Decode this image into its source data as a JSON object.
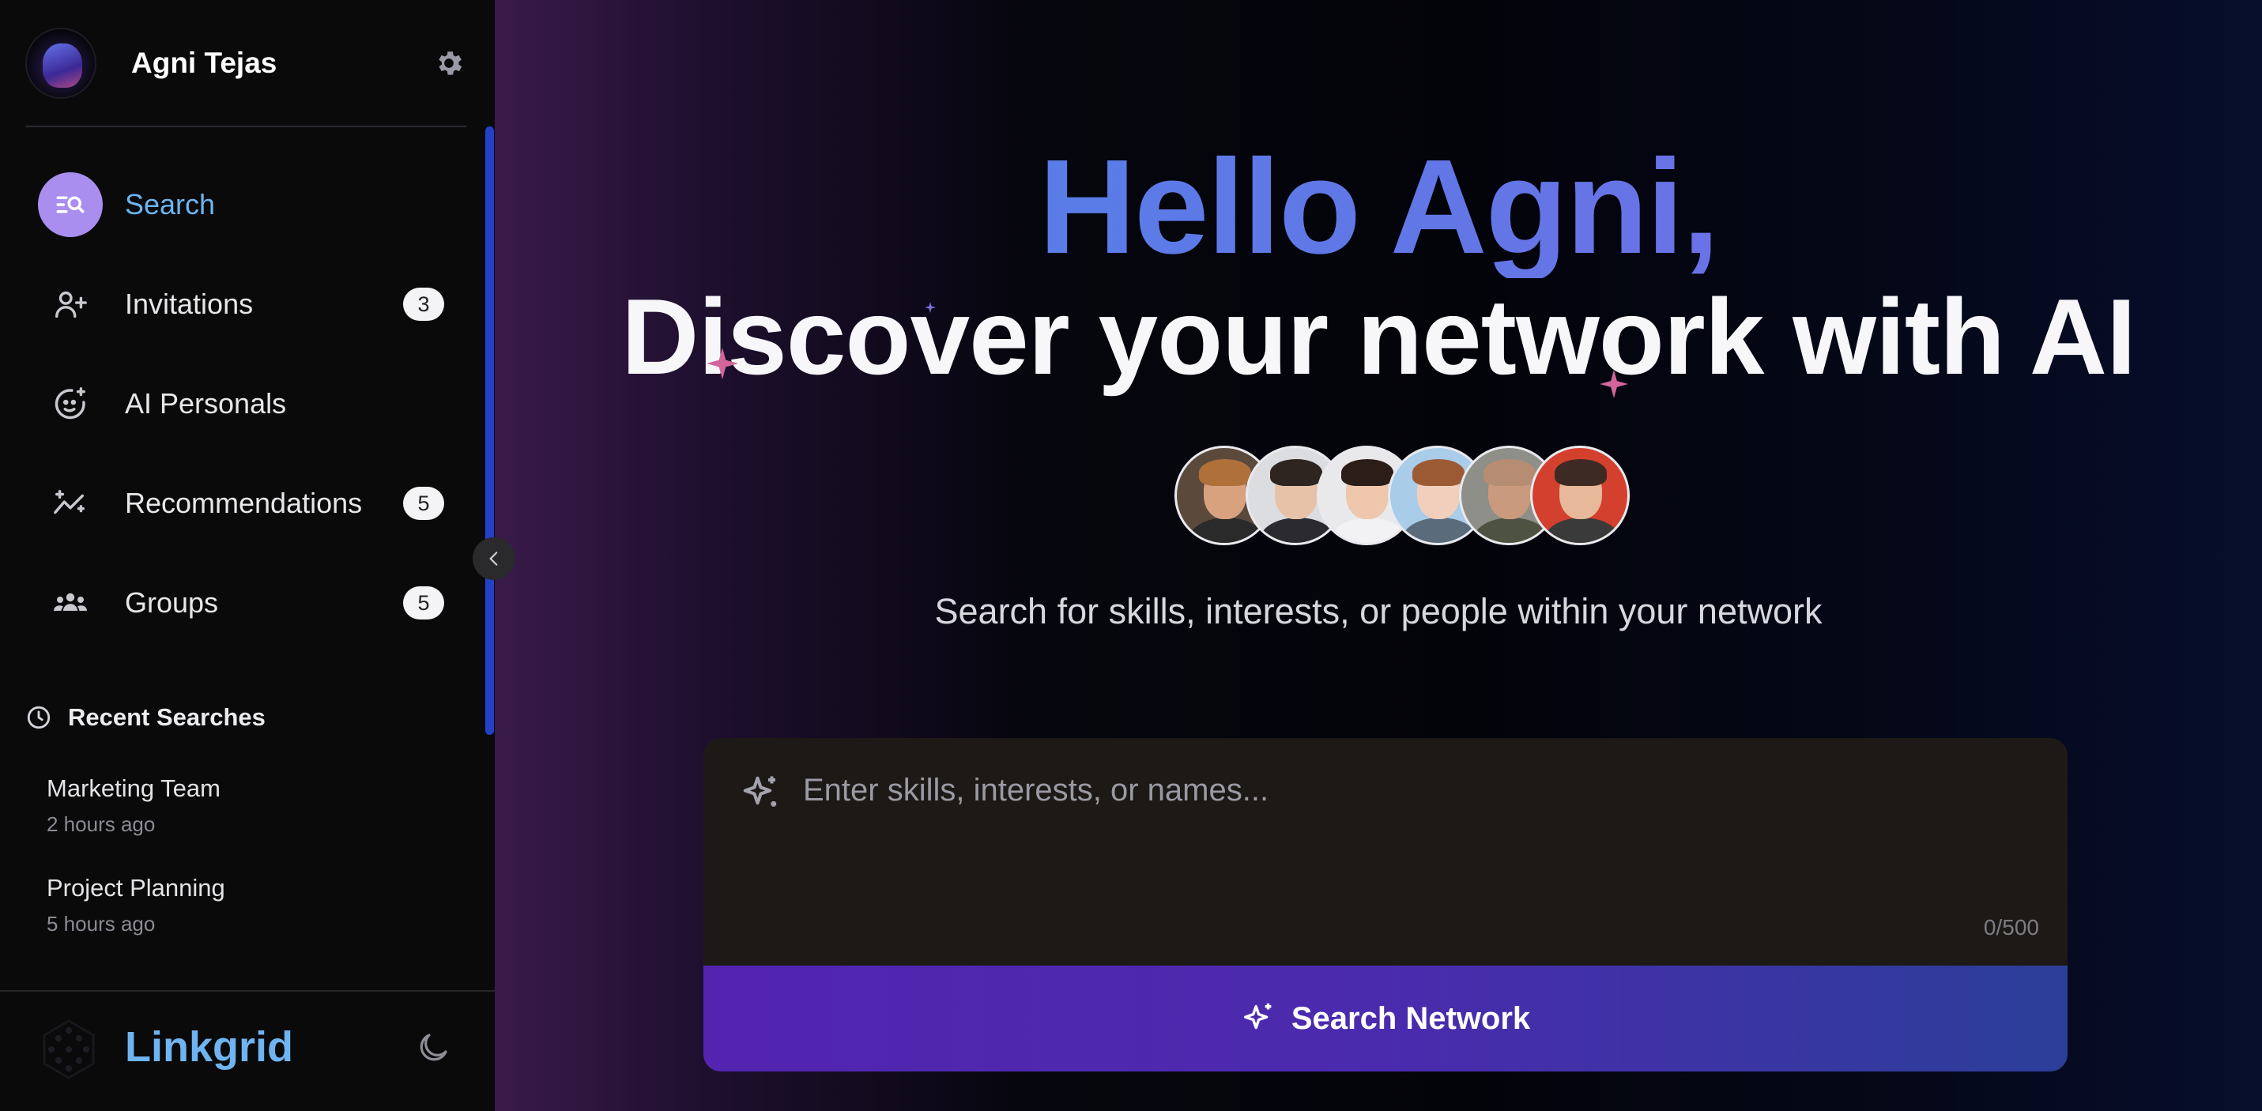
{
  "user": {
    "name": "Agni Tejas"
  },
  "nav": [
    {
      "label": "Search",
      "icon": "search-list-icon",
      "badge": null,
      "active": true
    },
    {
      "label": "Invitations",
      "icon": "user-plus-icon",
      "badge": "3",
      "active": false
    },
    {
      "label": "AI Personals",
      "icon": "face-sparkle-icon",
      "badge": null,
      "active": false
    },
    {
      "label": "Recommendations",
      "icon": "trend-sparkle-icon",
      "badge": "5",
      "active": false
    },
    {
      "label": "Groups",
      "icon": "users-group-icon",
      "badge": "5",
      "active": false
    }
  ],
  "recent": {
    "title": "Recent Searches",
    "items": [
      {
        "name": "Marketing Team",
        "time": "2 hours ago"
      },
      {
        "name": "Project Planning",
        "time": "5 hours ago"
      }
    ]
  },
  "brand": {
    "name": "Linkgrid"
  },
  "hero": {
    "greeting": "Hello Agni,",
    "headline": "Discover your network with AI",
    "subtitle": "Search for skills, interests, or people within your network"
  },
  "search": {
    "placeholder": "Enter skills, interests, or names...",
    "value": "",
    "char_count": "0/500",
    "button_label": "Search Network"
  },
  "colors": {
    "accent_blue": "#6cb5f2",
    "active_icon_bg": "#a98ef0",
    "button_start": "#5324b0",
    "button_end": "#2b3e99"
  }
}
